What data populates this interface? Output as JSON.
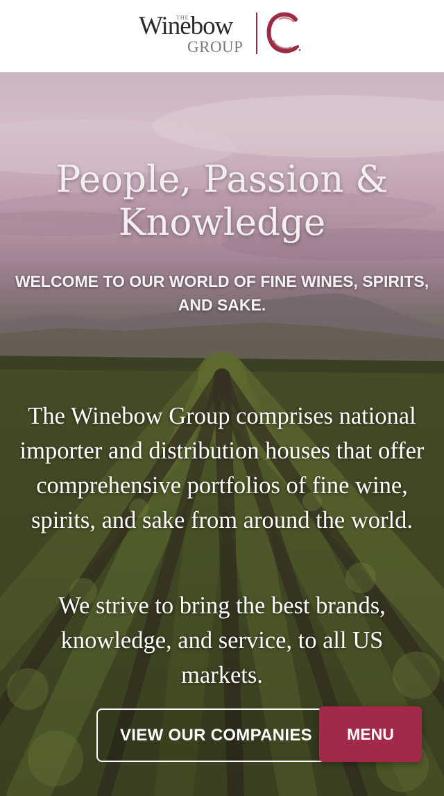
{
  "header": {
    "logo": {
      "the": "THE",
      "wordmark": "Winebow",
      "group": "GROUP"
    }
  },
  "hero": {
    "headline": "People, Passion & Knowledge",
    "subheadline": "WELCOME TO OUR WORLD OF FINE WINES, SPIRITS, AND SAKE.",
    "paragraphs": [
      "The Winebow Group comprises national importer and distribution houses that offer comprehensive portfolios of fine wine, spirits, and sake from around the world.",
      "We strive to bring the best brands, knowledge, and service, to all US markets."
    ],
    "cta_label": "VIEW OUR COMPANIES"
  },
  "menu": {
    "label": "MENU"
  },
  "colors": {
    "brand_burgundy": "#a3294a",
    "logo_text": "#2a2a2a",
    "logo_divider": "#9b2c44"
  }
}
